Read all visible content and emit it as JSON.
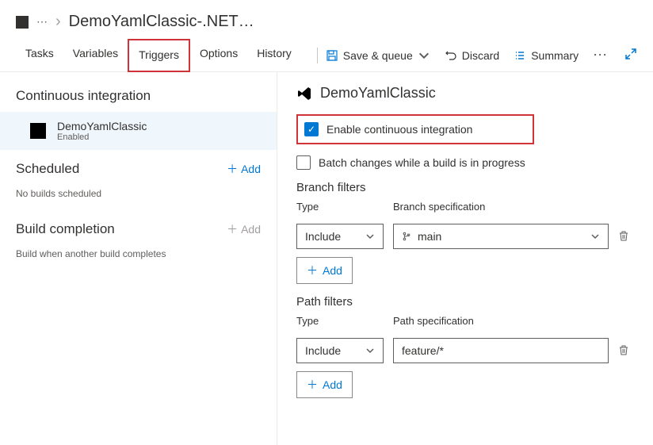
{
  "breadcrumb": {
    "current": "DemoYamlClassic-.NET…"
  },
  "tabs": {
    "tasks": "Tasks",
    "variables": "Variables",
    "triggers": "Triggers",
    "options": "Options",
    "history": "History"
  },
  "toolbar": {
    "save_queue": "Save & queue",
    "discard": "Discard",
    "summary": "Summary"
  },
  "sidebar": {
    "ci_title": "Continuous integration",
    "repo": {
      "name": "DemoYamlClassic",
      "status": "Enabled"
    },
    "scheduled_title": "Scheduled",
    "scheduled_add": "Add",
    "scheduled_empty": "No builds scheduled",
    "build_completion_title": "Build completion",
    "build_completion_add": "Add",
    "build_completion_empty": "Build when another build completes"
  },
  "content": {
    "title": "DemoYamlClassic",
    "enable_ci": "Enable continuous integration",
    "batch_changes": "Batch changes while a build is in progress",
    "branch_filters": {
      "title": "Branch filters",
      "type_label": "Type",
      "spec_label": "Branch specification",
      "type_value": "Include",
      "spec_value": "main",
      "add": "Add"
    },
    "path_filters": {
      "title": "Path filters",
      "type_label": "Type",
      "spec_label": "Path specification",
      "type_value": "Include",
      "spec_value": "feature/*",
      "add": "Add"
    }
  }
}
